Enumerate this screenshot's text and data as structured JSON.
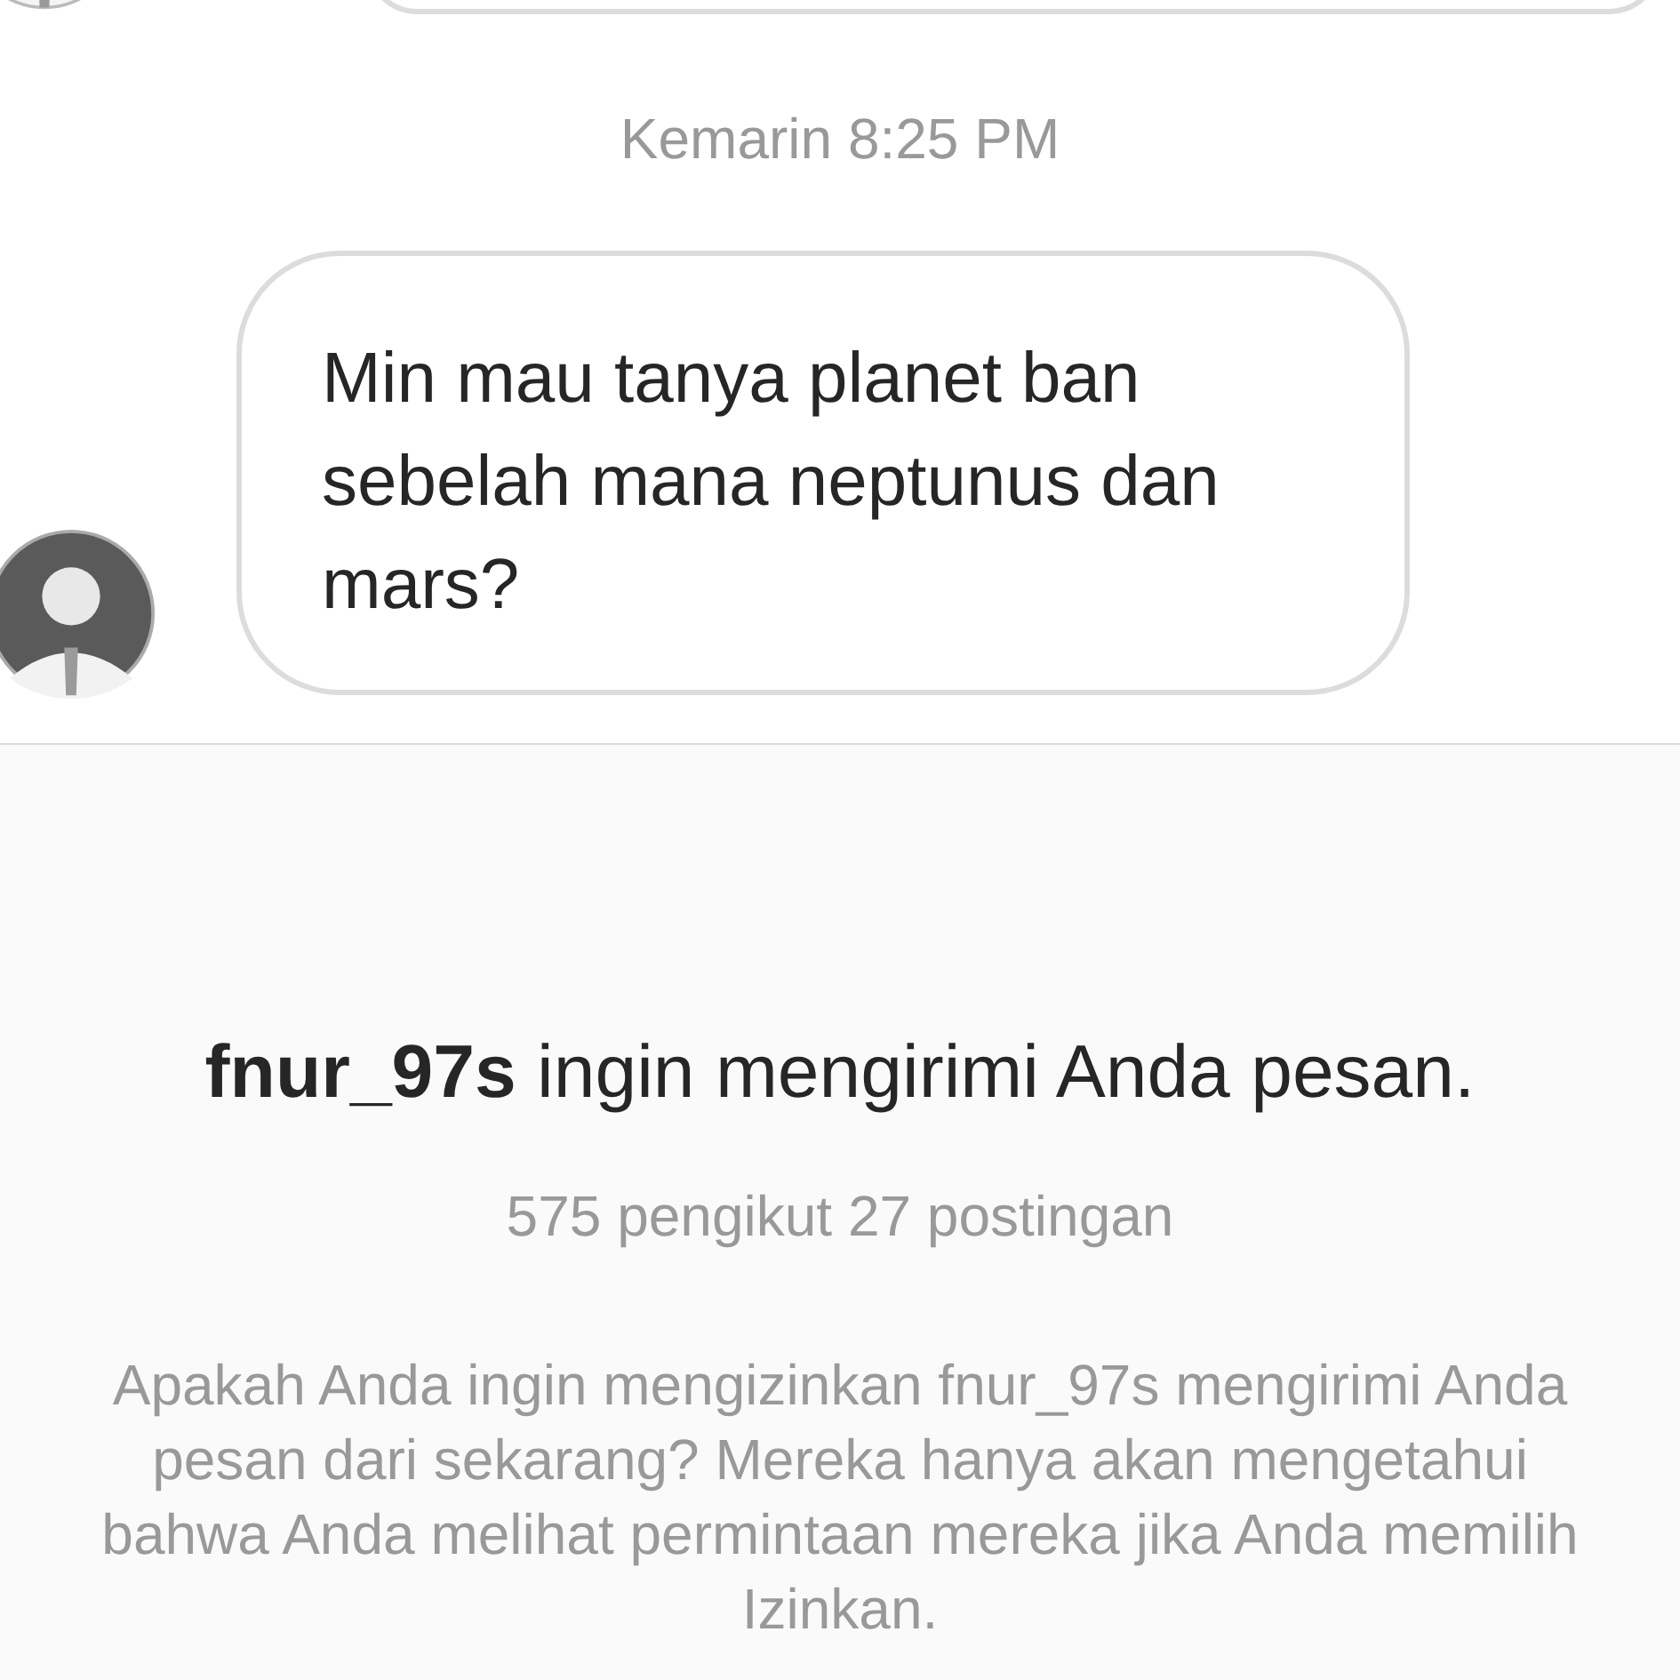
{
  "timestamp": "Kemarin 8:25 PM",
  "message": {
    "text": "Min mau tanya planet ban sebelah mana neptunus dan mars?"
  },
  "request": {
    "username": "fnur_97s",
    "title_rest": " ingin mengirimi Anda pesan.",
    "stats": "575 pengikut 27 postingan",
    "description": "Apakah Anda ingin mengizinkan fnur_97s mengirimi Anda pesan dari sekarang? Mereka hanya akan mengetahui bahwa Anda melihat permintaan mereka jika Anda memilih Izinkan."
  }
}
